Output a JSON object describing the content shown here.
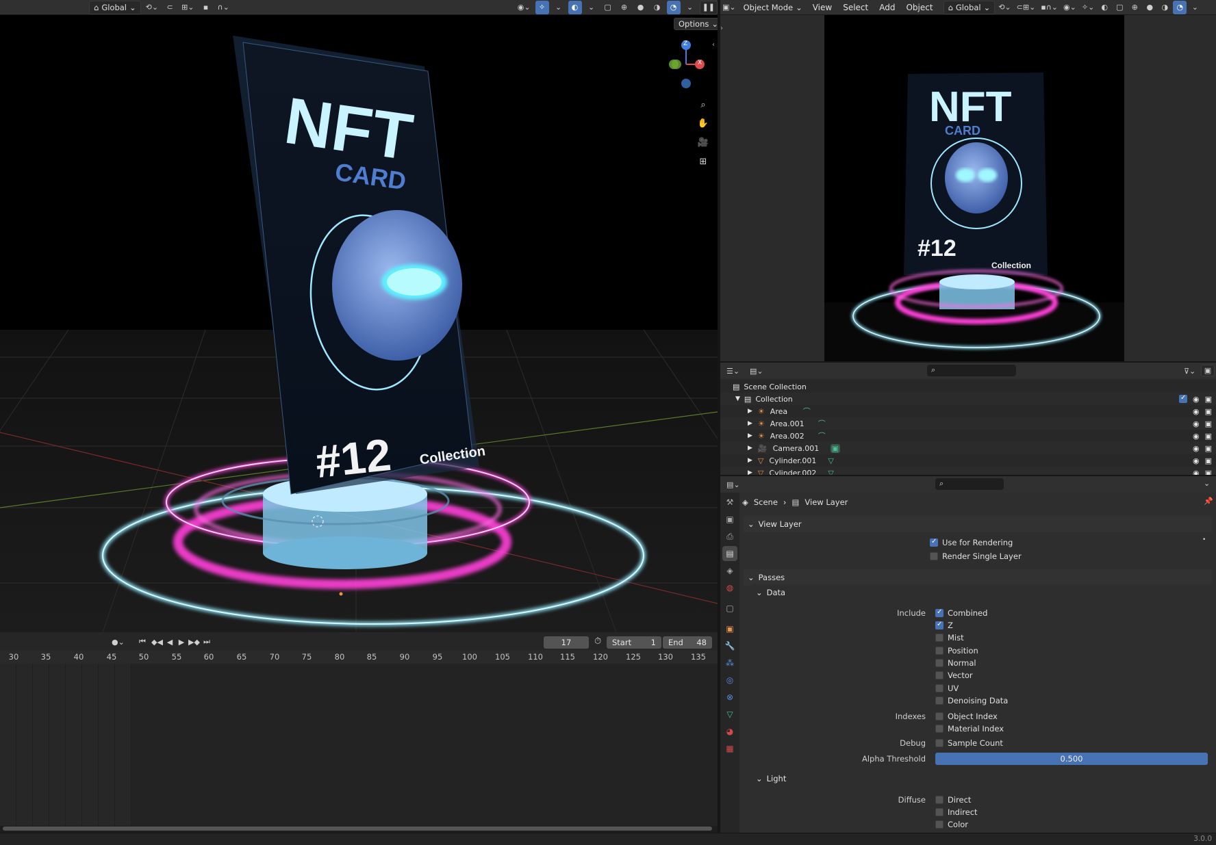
{
  "left_header": {
    "orientation": "Global"
  },
  "viewport": {
    "options_label": "Options",
    "gizmo": {
      "z": "Z",
      "x": "X"
    },
    "card": {
      "title": "NFT",
      "subtitle": "CARD",
      "number": "#12",
      "tag": "Collection"
    }
  },
  "right_header": {
    "mode": "Object Mode",
    "menus": [
      "View",
      "Select",
      "Add",
      "Object"
    ],
    "orientation": "Global"
  },
  "timeline": {
    "current_frame": "17",
    "start_label": "Start",
    "start_value": "1",
    "end_label": "End",
    "end_value": "48",
    "ticks": [
      "30",
      "35",
      "40",
      "45",
      "50",
      "55",
      "60",
      "65",
      "70",
      "75",
      "80",
      "85",
      "90",
      "95",
      "100",
      "105",
      "110",
      "115",
      "120",
      "125",
      "130",
      "135"
    ]
  },
  "outliner": {
    "scene_collection": "Scene Collection",
    "collection": "Collection",
    "items": [
      {
        "name": "Area",
        "icon": "light-icon",
        "color": "#e8944a"
      },
      {
        "name": "Area.001",
        "icon": "light-icon",
        "color": "#e8944a"
      },
      {
        "name": "Area.002",
        "icon": "light-icon",
        "color": "#e8944a"
      },
      {
        "name": "Camera.001",
        "icon": "camera-icon",
        "color": "#e8944a"
      },
      {
        "name": "Cylinder.001",
        "icon": "mesh-icon",
        "color": "#e8944a"
      },
      {
        "name": "Cylinder.002",
        "icon": "mesh-icon",
        "color": "#e8944a"
      }
    ]
  },
  "properties": {
    "breadcrumb": {
      "scene": "Scene",
      "layer": "View Layer"
    },
    "view_layer_panel": "View Layer",
    "use_for_rendering": "Use for Rendering",
    "render_single_layer": "Render Single Layer",
    "passes_panel": "Passes",
    "data_panel": "Data",
    "include_label": "Include",
    "include": [
      {
        "label": "Combined",
        "checked": true
      },
      {
        "label": "Z",
        "checked": true
      },
      {
        "label": "Mist",
        "checked": false
      },
      {
        "label": "Position",
        "checked": false
      },
      {
        "label": "Normal",
        "checked": false
      },
      {
        "label": "Vector",
        "checked": false
      },
      {
        "label": "UV",
        "checked": false
      },
      {
        "label": "Denoising Data",
        "checked": false
      }
    ],
    "indexes_label": "Indexes",
    "indexes": [
      {
        "label": "Object Index",
        "checked": false
      },
      {
        "label": "Material Index",
        "checked": false
      }
    ],
    "debug_label": "Debug",
    "sample_count": "Sample Count",
    "alpha_threshold_label": "Alpha Threshold",
    "alpha_threshold_value": "0.500",
    "light_panel": "Light",
    "diffuse_label": "Diffuse",
    "diffuse": [
      {
        "label": "Direct",
        "checked": false
      },
      {
        "label": "Indirect",
        "checked": false
      },
      {
        "label": "Color",
        "checked": false
      }
    ]
  },
  "status": {
    "version": "3.0.0"
  },
  "colors": {
    "accent": "#4772b3",
    "neon_pink": "#ff3fd8",
    "neon_cyan": "#8fe9ff"
  }
}
